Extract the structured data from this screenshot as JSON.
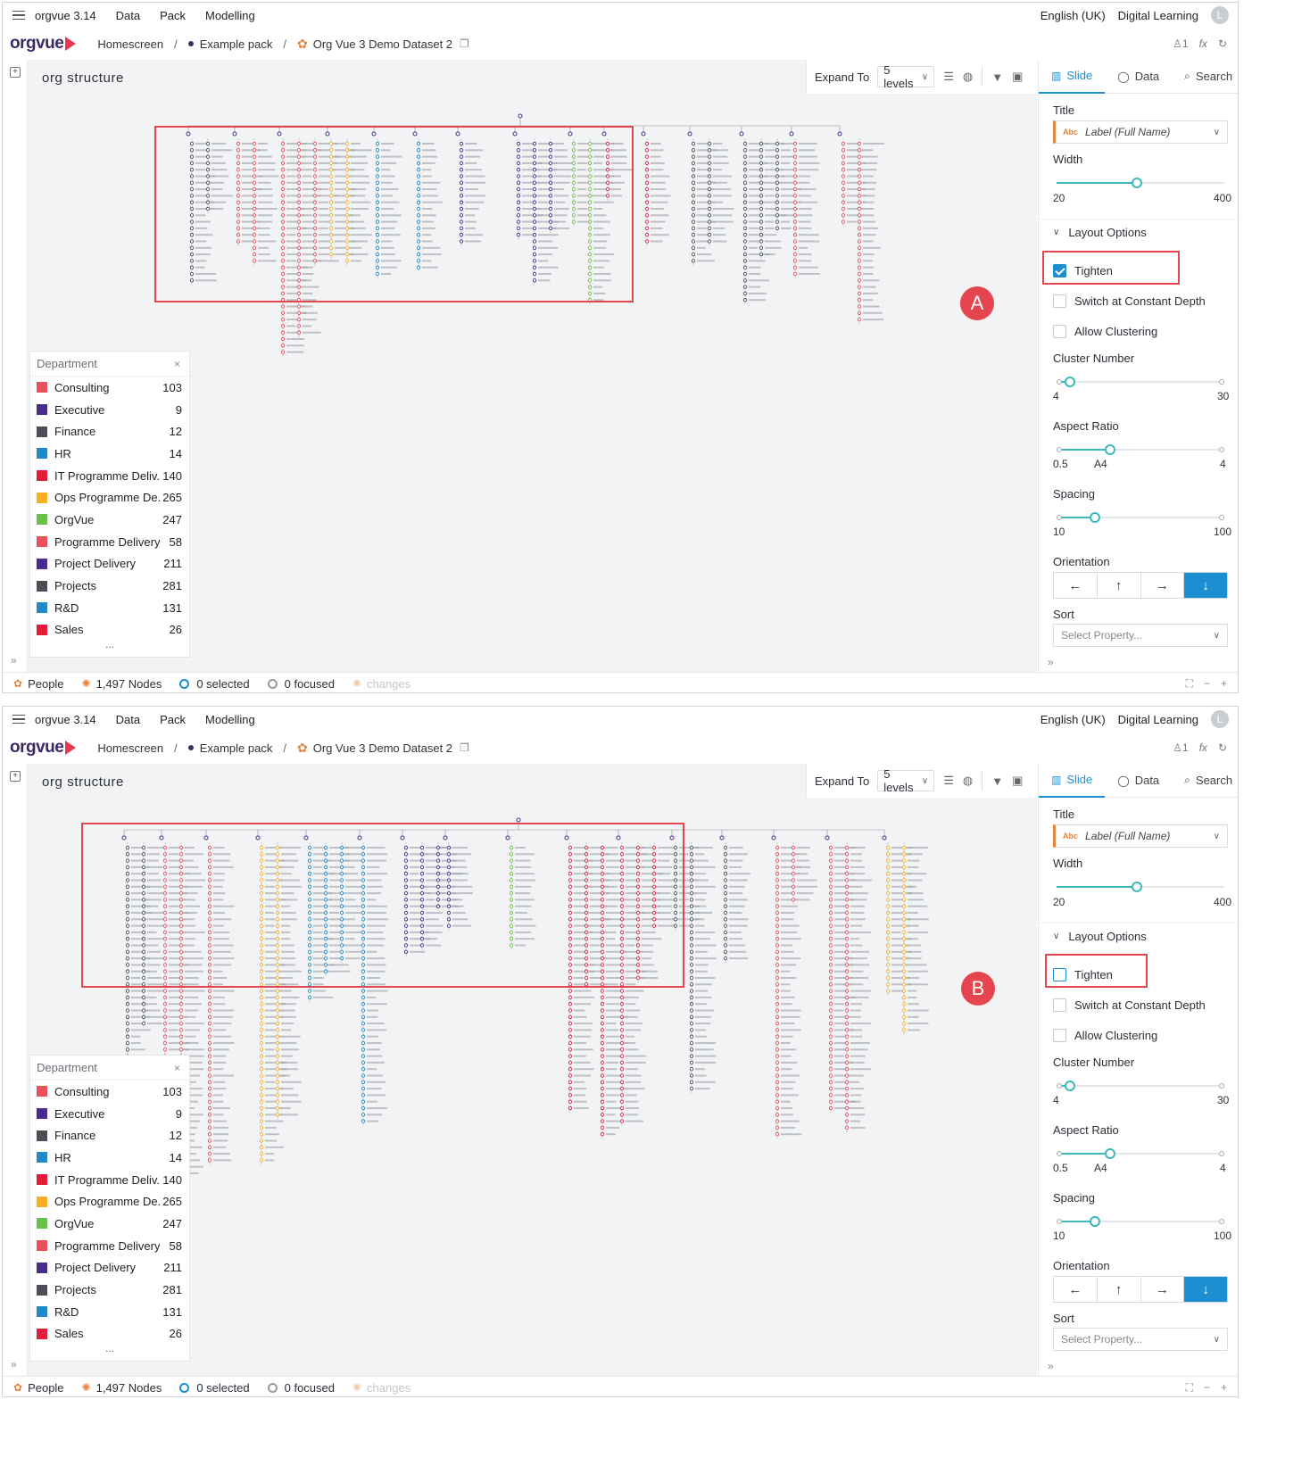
{
  "app": {
    "title": "orgvue 3.14",
    "menu": [
      "Data",
      "Pack",
      "Modelling"
    ],
    "language": "English (UK)",
    "help": "Digital Learning",
    "avatar_initial": "L",
    "logo_text": "orgvue",
    "user_count": "1",
    "formula_icon_text": "fx"
  },
  "breadcrumb": {
    "home": "Homescreen",
    "pack": "Example pack",
    "dataset": "Org Vue 3 Demo Dataset 2"
  },
  "view": {
    "title": "org structure",
    "expand_label": "Expand To",
    "expand_value": "5 levels"
  },
  "legend": {
    "title": "Department",
    "more": "...",
    "items": [
      {
        "name": "Consulting",
        "count": "103",
        "color": "#e8505b"
      },
      {
        "name": "Executive",
        "count": "9",
        "color": "#4b2a8c"
      },
      {
        "name": "Finance",
        "count": "12",
        "color": "#4a4f55"
      },
      {
        "name": "HR",
        "count": "14",
        "color": "#1f8ac8"
      },
      {
        "name": "IT Programme Deliv...",
        "count": "140",
        "color": "#e01e3c"
      },
      {
        "name": "Ops Programme De...",
        "count": "265",
        "color": "#f5b025"
      },
      {
        "name": "OrgVue",
        "count": "247",
        "color": "#6cc04a"
      },
      {
        "name": "Programme Delivery",
        "count": "58",
        "color": "#e8505b"
      },
      {
        "name": "Project Delivery",
        "count": "211",
        "color": "#4b2a8c"
      },
      {
        "name": "Projects",
        "count": "281",
        "color": "#4a4f55"
      },
      {
        "name": "R&D",
        "count": "131",
        "color": "#1f8ac8"
      },
      {
        "name": "Sales",
        "count": "26",
        "color": "#e01e3c"
      }
    ]
  },
  "panel": {
    "tabs": [
      "Slide",
      "Data",
      "Search"
    ],
    "title_label": "Title",
    "title_value": "Label (Full Name)",
    "title_type": "Abc",
    "width_label": "Width",
    "width": {
      "min": "20",
      "max": "400",
      "value": 0.48
    },
    "layout_options": "Layout Options",
    "tighten": "Tighten",
    "switch_depth": "Switch at Constant Depth",
    "allow_clustering": "Allow Clustering",
    "cluster_label": "Cluster Number",
    "cluster": {
      "min": "4",
      "max": "30",
      "value": 0.08
    },
    "aspect_label": "Aspect Ratio",
    "aspect": {
      "min": "0.5",
      "mid": "A4",
      "max": "4",
      "value": 0.32
    },
    "spacing_label": "Spacing",
    "spacing": {
      "min": "10",
      "max": "100",
      "value": 0.23
    },
    "orientation_label": "Orientation",
    "orientation": [
      "←",
      "↑",
      "→",
      "↓"
    ],
    "sort_label": "Sort",
    "sort_placeholder": "Select Property..."
  },
  "status": {
    "people": "People",
    "nodes": "1,497 Nodes",
    "selected": "0 selected",
    "focused": "0 focused",
    "changes": "changes"
  },
  "panels": [
    {
      "badge": "A",
      "tighten_checked": true
    },
    {
      "badge": "B",
      "tighten_checked": false
    }
  ]
}
